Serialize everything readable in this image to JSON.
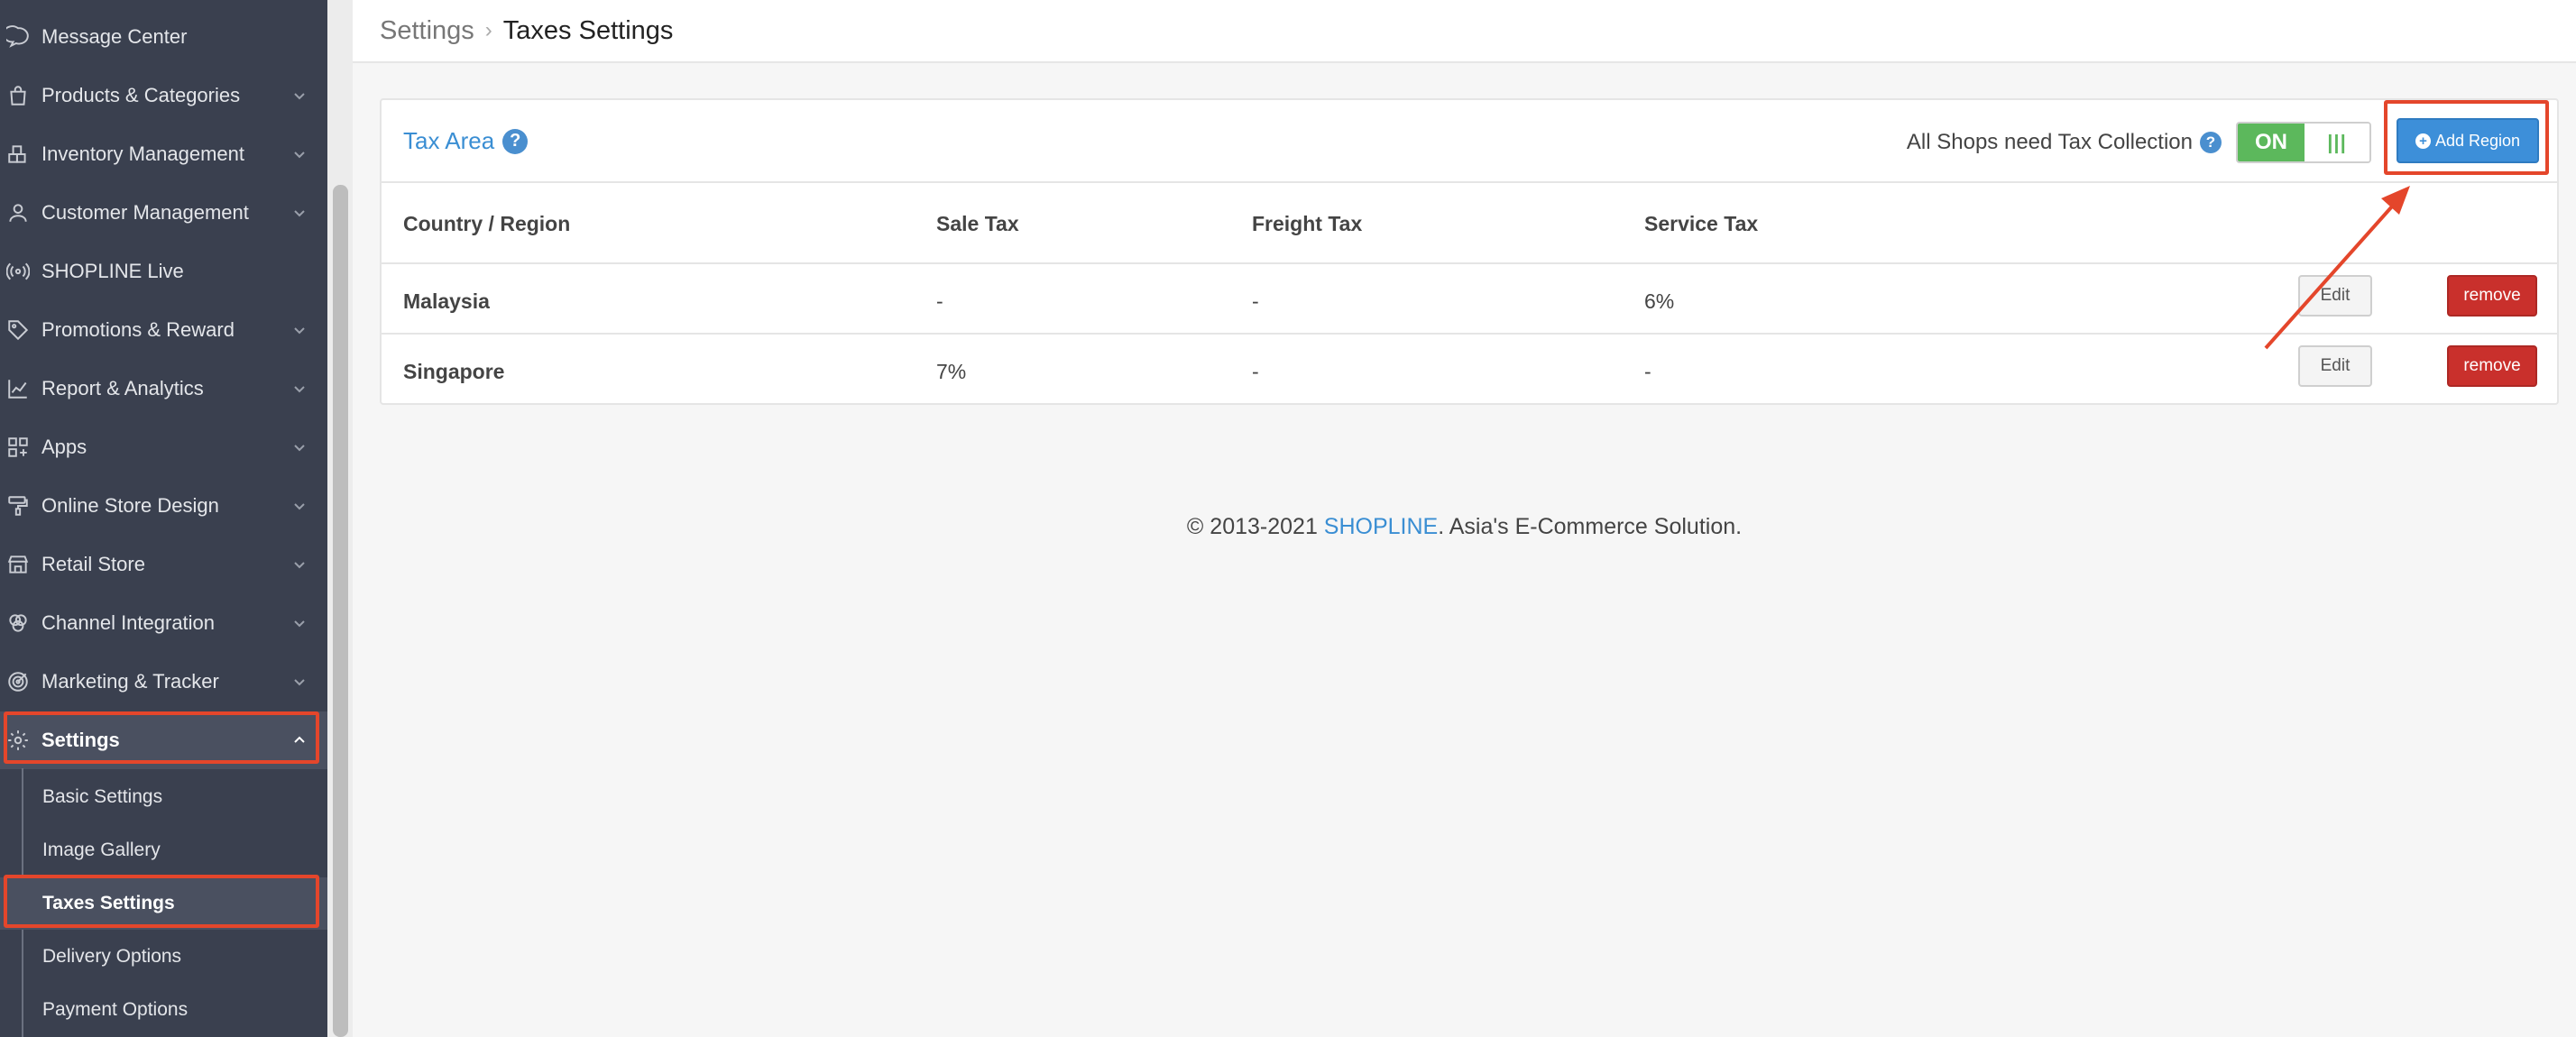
{
  "sidebar": {
    "items": [
      {
        "label": "Message Center",
        "icon": "chat-bubble-icon"
      },
      {
        "label": "Products & Categories",
        "icon": "shopping-bag-icon"
      },
      {
        "label": "Inventory Management",
        "icon": "inventory-icon"
      },
      {
        "label": "Customer Management",
        "icon": "user-icon"
      },
      {
        "label": "SHOPLINE Live",
        "icon": "broadcast-icon"
      },
      {
        "label": "Promotions & Reward",
        "icon": "tag-icon"
      },
      {
        "label": "Report & Analytics",
        "icon": "chart-icon"
      },
      {
        "label": "Apps",
        "icon": "apps-grid-icon"
      },
      {
        "label": "Online Store Design",
        "icon": "paint-roller-icon"
      },
      {
        "label": "Retail Store",
        "icon": "store-icon"
      },
      {
        "label": "Channel Integration",
        "icon": "channels-icon"
      },
      {
        "label": "Marketing & Tracker",
        "icon": "target-icon"
      },
      {
        "label": "Settings",
        "icon": "gear-icon"
      }
    ],
    "settings_sub": [
      {
        "label": "Basic Settings"
      },
      {
        "label": "Image Gallery"
      },
      {
        "label": "Taxes Settings"
      },
      {
        "label": "Delivery Options"
      },
      {
        "label": "Payment Options"
      }
    ]
  },
  "breadcrumb": {
    "root": "Settings",
    "separator": "›",
    "current": "Taxes Settings"
  },
  "tax_area": {
    "title": "Tax Area",
    "help": "?",
    "collection_label": "All Shops need Tax Collection",
    "toggle_on": "ON",
    "toggle_knob": "|||",
    "add_button": "Add Region",
    "add_icon": "+",
    "columns": [
      "Country / Region",
      "Sale Tax",
      "Freight Tax",
      "Service Tax"
    ],
    "rows": [
      {
        "country": "Malaysia",
        "sale": "-",
        "freight": "-",
        "service": "6%",
        "edit": "Edit",
        "remove": "remove"
      },
      {
        "country": "Singapore",
        "sale": "7%",
        "freight": "-",
        "service": "-",
        "edit": "Edit",
        "remove": "remove"
      }
    ]
  },
  "footer": {
    "prefix": "© 2013-2021 ",
    "brand": "SHOPLINE",
    "suffix": ". Asia's E-Commerce Solution."
  },
  "colors": {
    "sidebar_bg": "#3a404f",
    "accent_blue": "#3a8ed3",
    "toggle_green": "#5cb85c",
    "remove_red": "#c9302c",
    "highlight": "#e4462b"
  }
}
